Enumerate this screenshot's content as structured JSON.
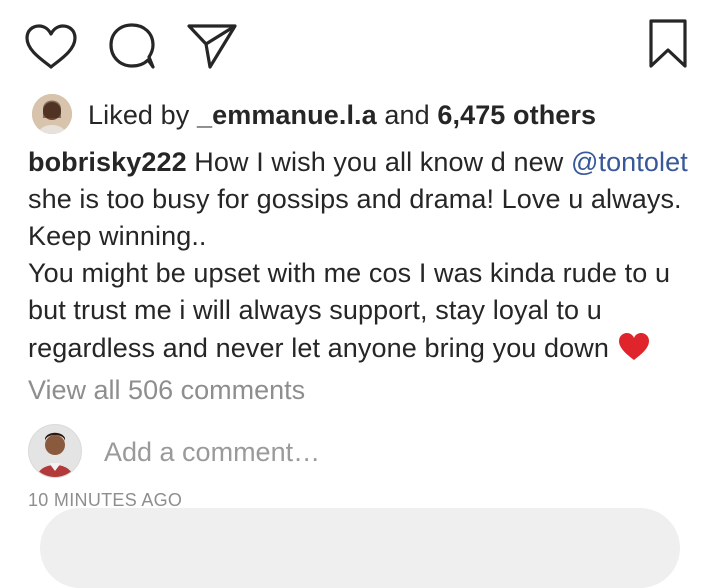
{
  "actions": {
    "like_icon": "heart-outline-icon",
    "comment_icon": "comment-bubble-icon",
    "share_icon": "paper-plane-icon",
    "save_icon": "bookmark-icon"
  },
  "likes": {
    "prefix": "Liked by",
    "user": "_emmanue.l.a",
    "joiner": "and",
    "others": "6,475 others"
  },
  "caption": {
    "username": "bobrisky222",
    "text_1": " How I wish you all know d new ",
    "mention": "@tontolet",
    "text_2": " she is too busy for gossips and drama! Love u always. Keep winning..",
    "text_3": "You might be upset with me cos I was kinda rude to u but trust me i will always support, stay loyal to u regardless and never let anyone bring you down ",
    "emoji": "❤️"
  },
  "comments": {
    "view_all": "View all 506 comments",
    "add_placeholder": "Add a comment…"
  },
  "timestamp": "10 MINUTES AGO",
  "colors": {
    "text": "#262626",
    "mention": "#385898",
    "muted": "#8e8e8e"
  }
}
